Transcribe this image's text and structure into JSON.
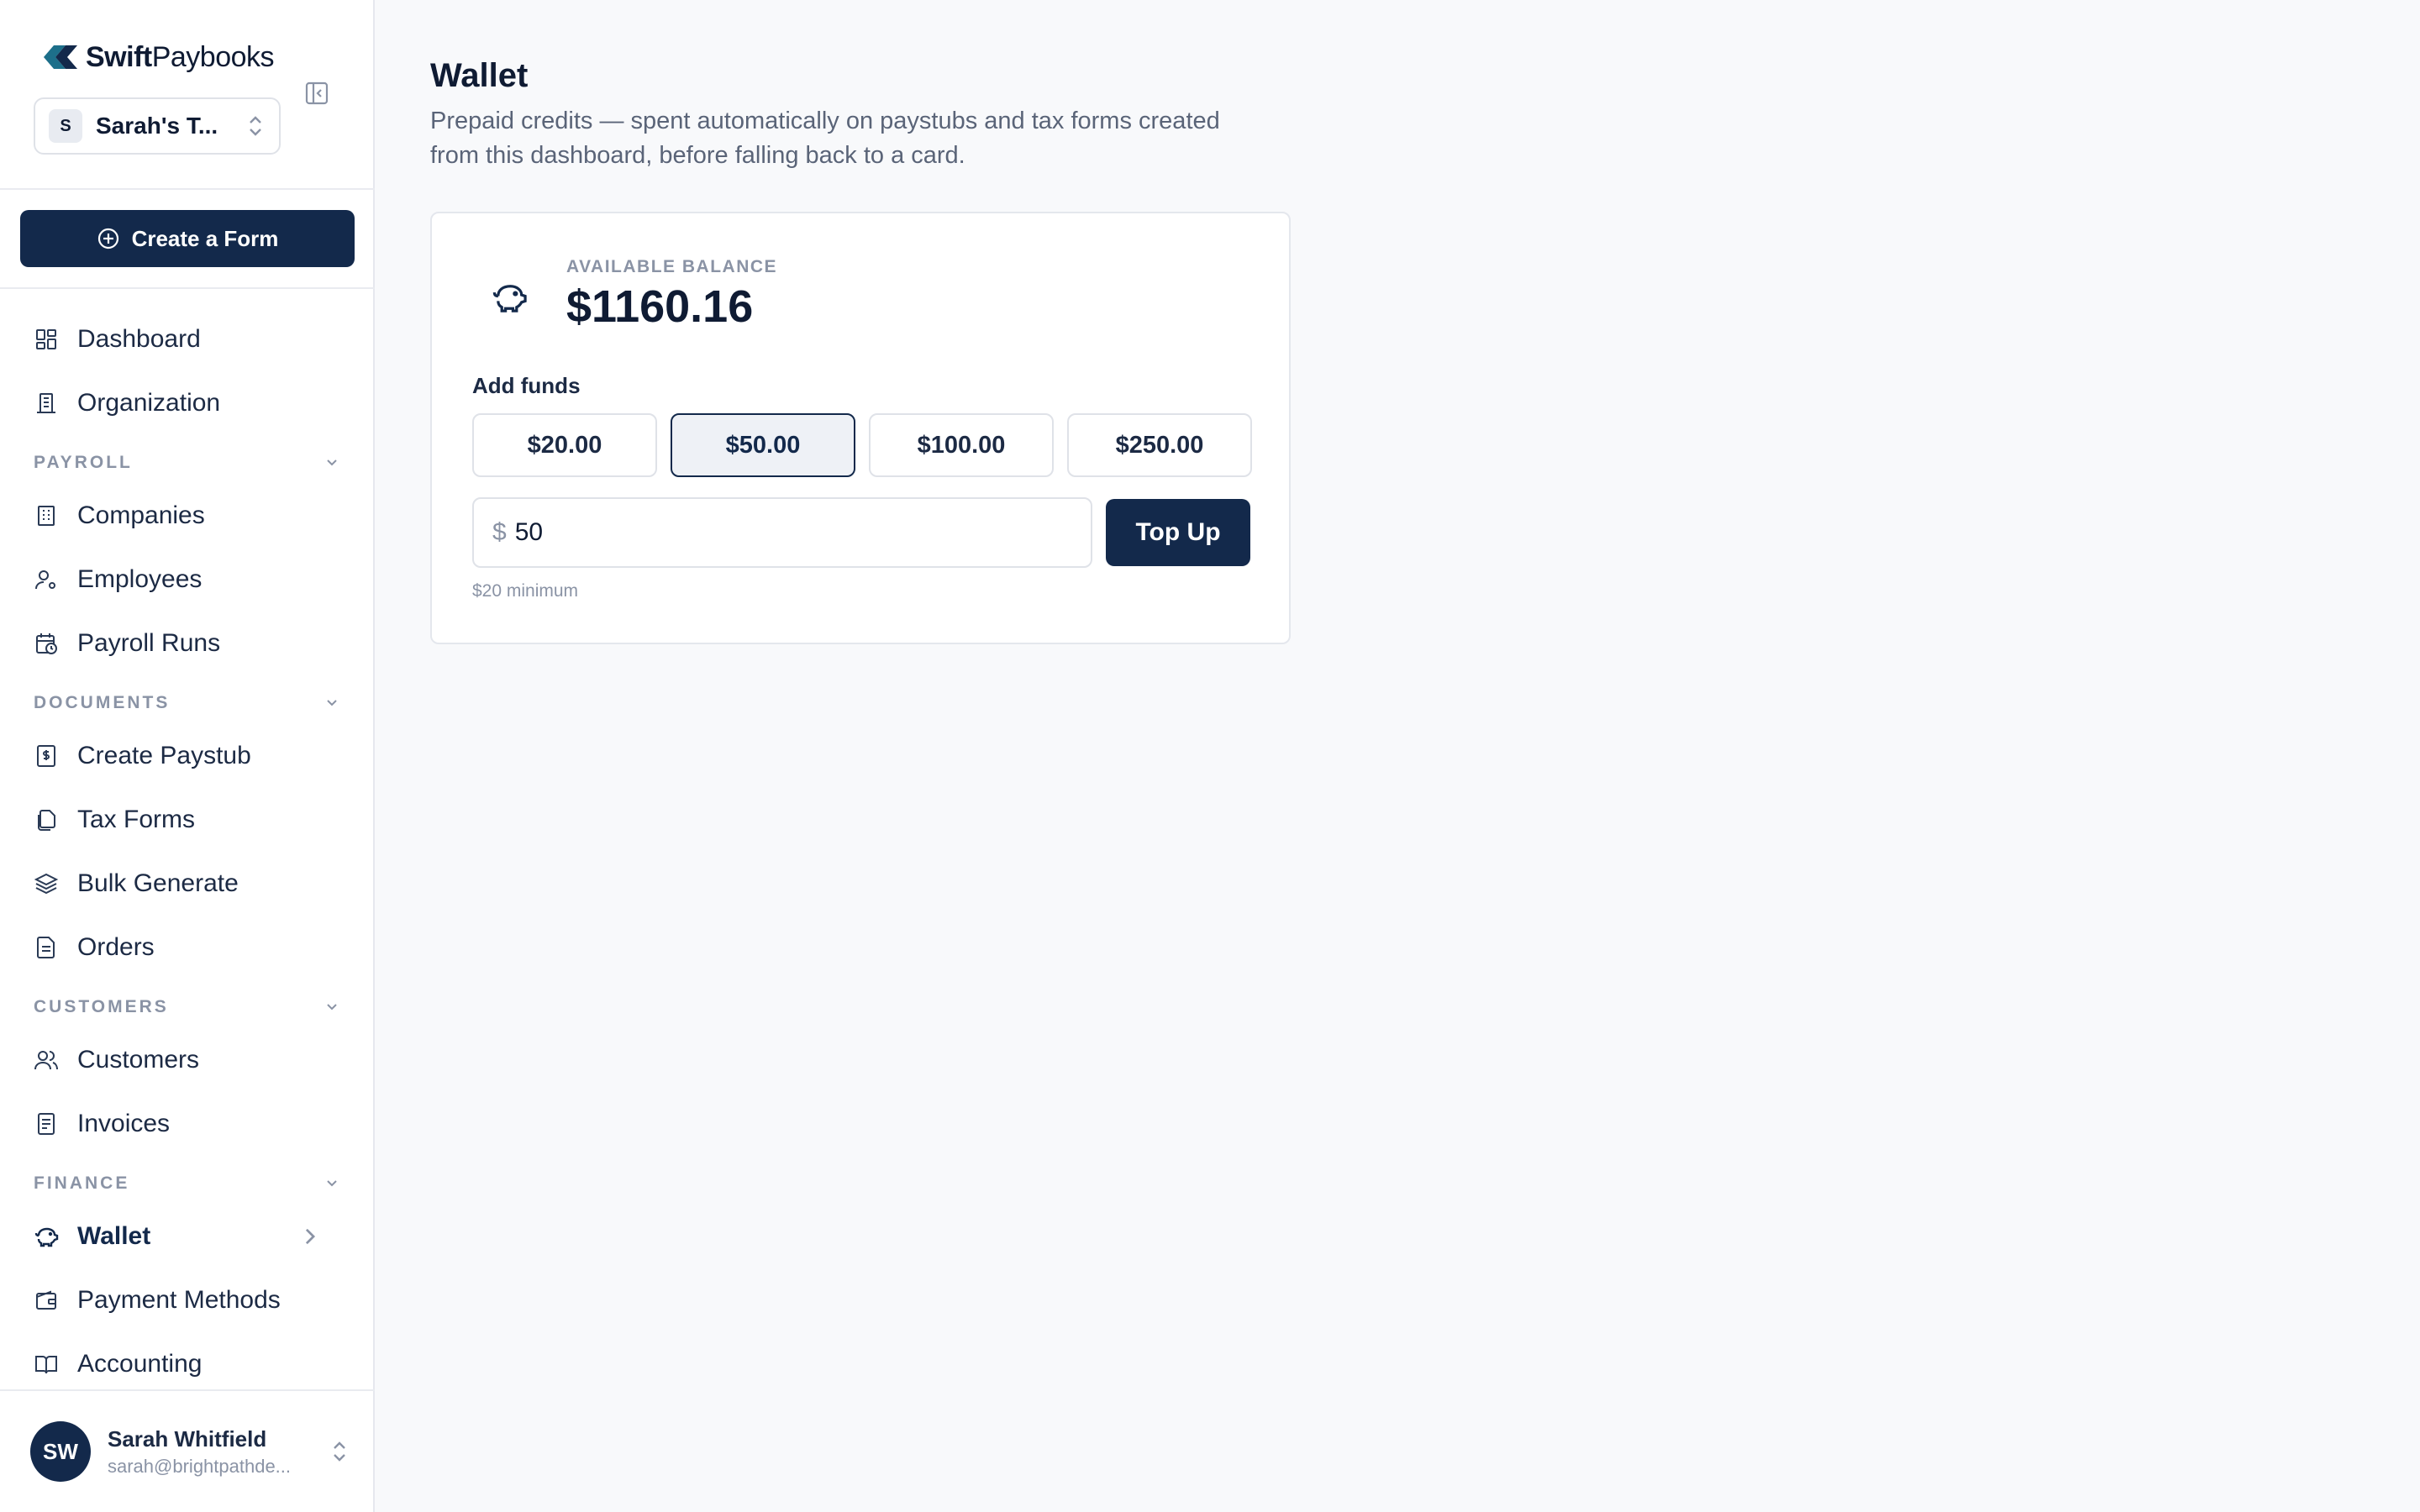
{
  "brand": {
    "bold": "Swift",
    "regular": "Paybooks"
  },
  "org": {
    "badge": "S",
    "name": "Sarah's T..."
  },
  "create_button": "Create a Form",
  "nav": {
    "dashboard": "Dashboard",
    "organization": "Organization",
    "payroll_section": "PAYROLL",
    "companies": "Companies",
    "employees": "Employees",
    "payroll_runs": "Payroll Runs",
    "documents_section": "DOCUMENTS",
    "create_paystub": "Create Paystub",
    "tax_forms": "Tax Forms",
    "bulk_generate": "Bulk Generate",
    "orders": "Orders",
    "customers_section": "CUSTOMERS",
    "customers": "Customers",
    "invoices": "Invoices",
    "finance_section": "FINANCE",
    "wallet": "Wallet",
    "payment_methods": "Payment Methods",
    "accounting": "Accounting"
  },
  "user": {
    "initials": "SW",
    "name": "Sarah Whitfield",
    "email": "sarah@brightpathde..."
  },
  "page": {
    "title": "Wallet",
    "subtitle": "Prepaid credits — spent automatically on paystubs and tax forms created from this dashboard, before falling back to a card."
  },
  "wallet": {
    "balance_label": "AVAILABLE BALANCE",
    "balance": "$1160.16",
    "add_funds_label": "Add funds",
    "presets": [
      "$20.00",
      "$50.00",
      "$100.00",
      "$250.00"
    ],
    "selected_preset": "$50.00",
    "currency_symbol": "$",
    "amount": "50",
    "topup_label": "Top Up",
    "minimum_note": "$20 minimum"
  },
  "colors": {
    "primary": "#13294b",
    "accent_teal": "#1d6f8a",
    "muted": "#8a93a5"
  }
}
